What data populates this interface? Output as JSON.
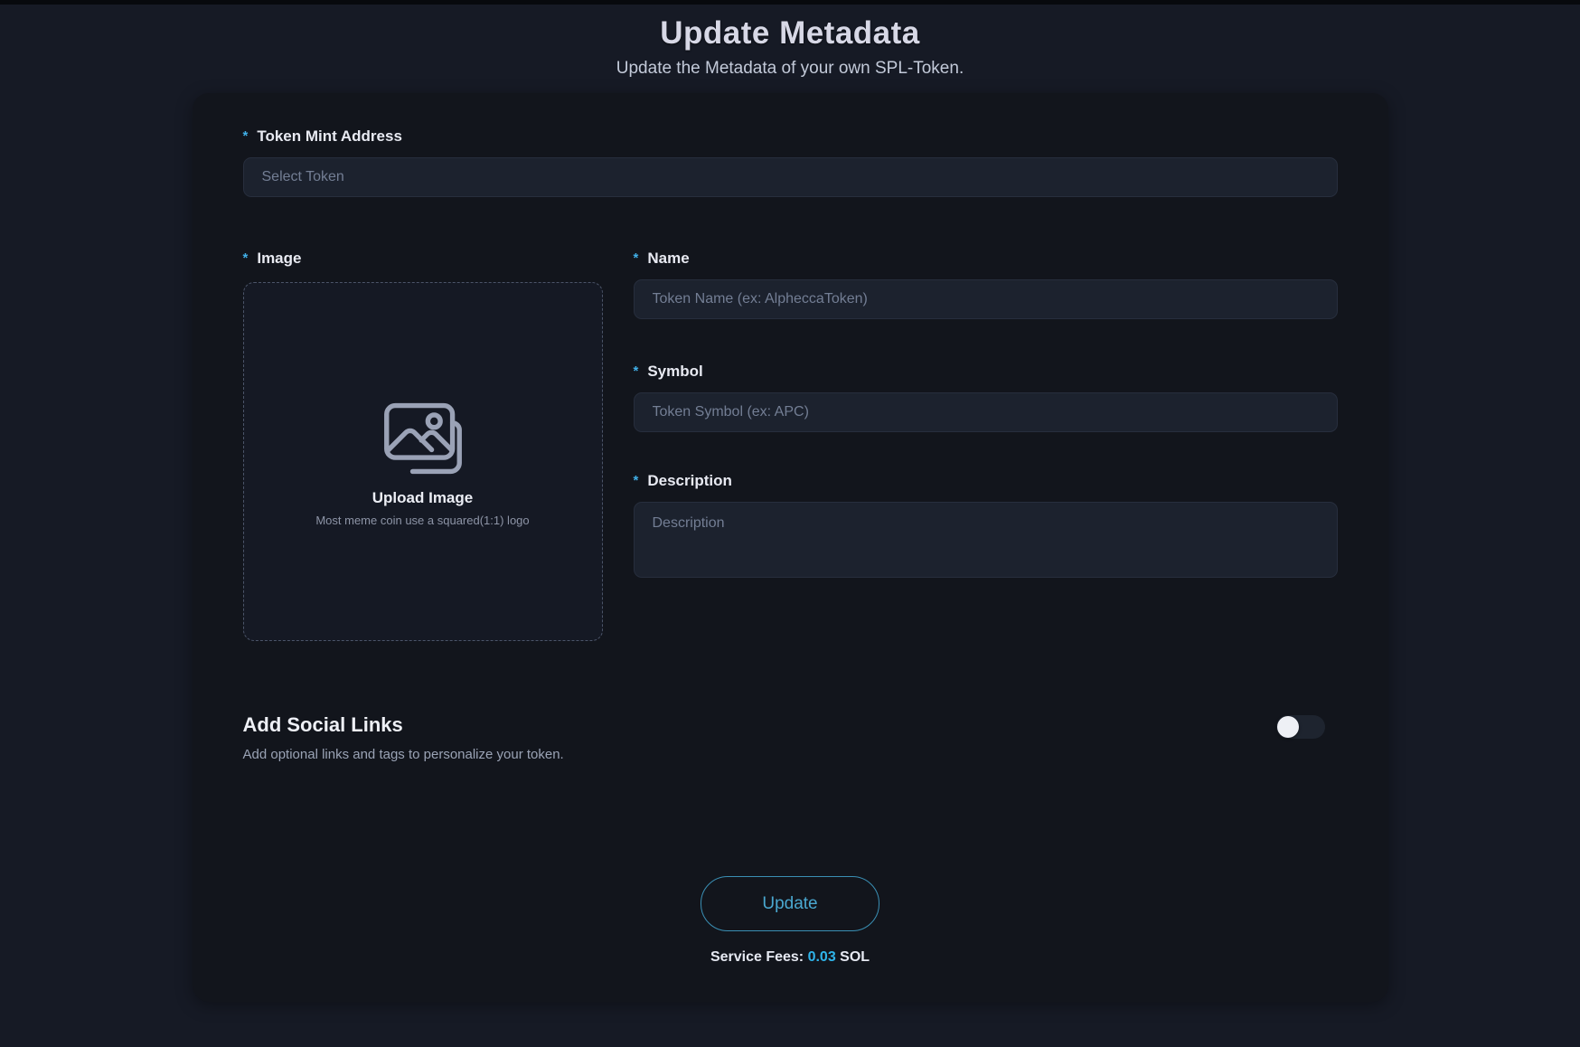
{
  "header": {
    "title": "Update Metadata",
    "subtitle": "Update the Metadata of your own SPL-Token."
  },
  "form": {
    "required_mark": "*",
    "token_mint": {
      "label": "Token Mint Address",
      "placeholder": "Select Token",
      "value": ""
    },
    "image": {
      "label": "Image",
      "icon": "images-icon",
      "upload_title": "Upload Image",
      "upload_hint": "Most meme coin use a squared(1:1) logo"
    },
    "name": {
      "label": "Name",
      "placeholder": "Token Name (ex: AlpheccaToken)",
      "value": ""
    },
    "symbol": {
      "label": "Symbol",
      "placeholder": "Token Symbol (ex: APC)",
      "value": ""
    },
    "description": {
      "label": "Description",
      "placeholder": "Description",
      "value": ""
    }
  },
  "social": {
    "title": "Add Social Links",
    "subtitle": "Add optional links and tags to personalize your token.",
    "toggle_state": "off"
  },
  "footer": {
    "button_label": "Update",
    "fee_prefix": "Service Fees:",
    "fee_value": "0.03",
    "fee_suffix": "SOL"
  },
  "colors": {
    "accent_cyan": "#3aa8d8",
    "fee_value_cyan": "#2fb4ea",
    "asterisk_blue": "#41b0e8",
    "page_bg": "#161a25",
    "card_bg": "#12151c",
    "input_bg": "#1c222e",
    "toggle_knob": "#eef0f5"
  }
}
